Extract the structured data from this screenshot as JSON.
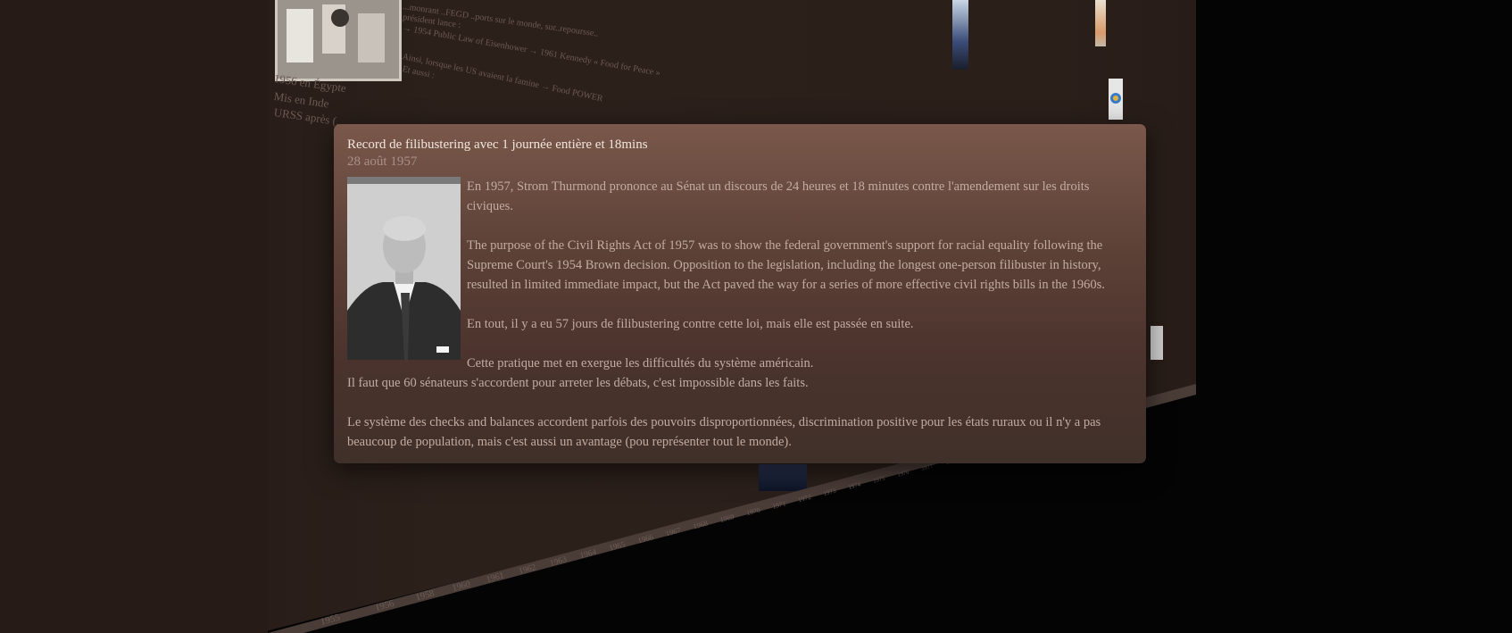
{
  "background": {
    "left_texts": [
      "1956 en Égypte",
      "Mis en Inde",
      "URSS après (.."
    ],
    "top_texts": [
      "...monrant ..FEGD ..ports sur le monde, sur..repoursse..",
      "président lance :",
      "→ 1954 Public Law of Eisenhower → 1961 Kennedy « Food for Peace »",
      "Ainsi, lorsque les  US avaient la famine → Food POWER",
      "Et aussi :"
    ],
    "timeline_labels": [
      "1955",
      "1956",
      "1958",
      "1960",
      "1961",
      "1962",
      "1963",
      "1964",
      "1965",
      "1966",
      "1967",
      "1968",
      "1969",
      "1970",
      "1971",
      "1972",
      "1973",
      "1974",
      "1975",
      "1976",
      "1977",
      "1978"
    ]
  },
  "popup": {
    "title": "Record de filibustering avec 1 journée entière et 18mins",
    "date": "28 août 1957",
    "image_alt": "portrait-photo",
    "paragraphs": [
      "En 1957, Strom Thurmond prononce au Sénat un discours de 24 heures et 18 minutes contre l'amendement sur les droits civiques.",
      "The purpose of the Civil Rights Act of 1957 was to show the federal government's support for racial equality following the Supreme Court's 1954 Brown decision. Opposition to the legislation, including the longest one-person filibuster in history, resulted in limited immediate impact, but the Act paved the way for a series of more effective civil rights bills in the 1960s.",
      "En tout, il y a eu 57 jours de filibustering contre cette loi, mais elle est passée en suite.",
      "Cette pratique met en exergue les difficultés du système américain."
    ],
    "line_after": "Il faut que 60 sénateurs s'accordent pour arreter les débats, c'est impossible dans les faits.",
    "final_paragraph": "Le système des checks and balances accordent parfois des pouvoirs disproportionnées, discrimination positive pour les états ruraux ou il n'y a pas beaucoup de population, mais c'est aussi un avantage (pou représenter tout le monde)."
  },
  "colors": {
    "popup_top": "#7a584b",
    "popup_bottom": "#40302a",
    "wall": "#2a1d19",
    "page": "#050404"
  }
}
